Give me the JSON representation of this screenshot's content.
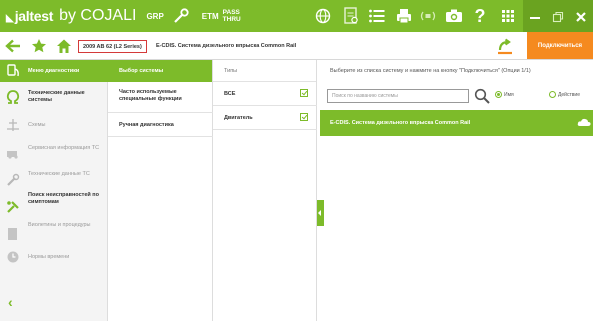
{
  "toolbar": {
    "logo_mark": "◣",
    "logo_name": "jaltest",
    "logo_sub": "by COJALI",
    "grp_label": "GRP",
    "etm_label": "ETM",
    "pass_label": "PASS",
    "thru_label": "THRU",
    "help_label": "?"
  },
  "navbar": {
    "vehicle": "2009 AB 62 (L2 Series)",
    "system": "E-CDIS. Система дизельного впрыска Common Rail",
    "connect_label": "Подключиться"
  },
  "left_menu": {
    "items": [
      {
        "label": "Меню диагностики",
        "icon": "diagnostic-icon",
        "state": "active"
      },
      {
        "label": "Технические данные системы",
        "icon": "omega-icon",
        "state": "enabled"
      },
      {
        "label": "Схемы",
        "icon": "schematic-icon",
        "state": "disabled"
      },
      {
        "label": "Сервисная информация ТС",
        "icon": "service-icon",
        "state": "disabled"
      },
      {
        "label": "Технические данные ТС",
        "icon": "wrench-icon",
        "state": "disabled"
      },
      {
        "label": "Поиск неисправностей по симптомам",
        "icon": "symptom-icon",
        "state": "enabled"
      },
      {
        "label": "Виолетины и процедуры",
        "icon": "document-icon",
        "state": "disabled"
      },
      {
        "label": "Нормы времени",
        "icon": "clock-icon",
        "state": "disabled"
      }
    ],
    "back_label": "‹"
  },
  "col1": {
    "header": "Выбор системы",
    "items": [
      "Часто используемые специальные функции",
      "Ручная диагностика"
    ]
  },
  "col2": {
    "header": "Типы",
    "rows": [
      {
        "label": "ВСЕ",
        "checked": true
      },
      {
        "label": "Двигатель",
        "checked": true
      }
    ]
  },
  "right": {
    "instruction": "Выберите из списка систему и нажмите на кнопку \"Подключиться\" (Опции 1/1)",
    "search_placeholder": "Поиск по названию системы",
    "radio_name": "Имя",
    "radio_action": "Действие",
    "result": "E-CDIS. Система дизельного впрыска Common Rail"
  },
  "colors": {
    "accent": "#7dbb2a",
    "orange": "#f58a1f",
    "highlight": "#d43a3a"
  }
}
